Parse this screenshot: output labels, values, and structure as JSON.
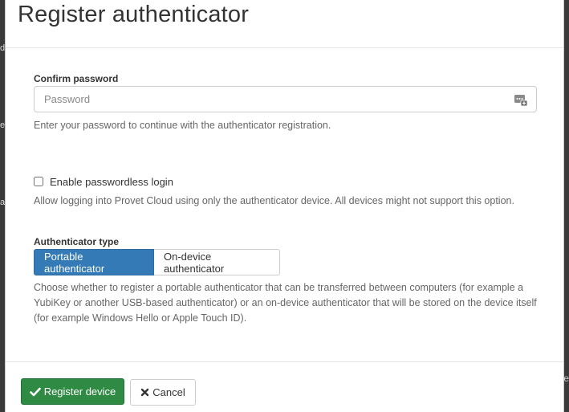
{
  "background": {
    "left_fragments": [
      "d",
      "e",
      "at"
    ],
    "right_fragment": "re"
  },
  "modal": {
    "title": "Register authenticator",
    "confirm_password": {
      "label": "Confirm password",
      "placeholder": "Password",
      "value": "",
      "help": "Enter your password to continue with the authenticator registration.",
      "icon": "password-manager-icon"
    },
    "passwordless": {
      "label": "Enable passwordless login",
      "checked": false,
      "help": "Allow logging into Provet Cloud using only the authenticator device. All devices might not support this option."
    },
    "authenticator_type": {
      "label": "Authenticator type",
      "options": [
        "Portable authenticator",
        "On-device authenticator"
      ],
      "selected": "Portable authenticator",
      "help": "Choose whether to register a portable authenticator that can be transferred between computers (for example a YubiKey or another USB-based authenticator) or an on-device authenticator that will be stored on the device itself (for example Windows Hello or Apple Touch ID)."
    },
    "footer": {
      "register_label": "Register device",
      "register_icon": "checkmark-icon",
      "cancel_label": "Cancel",
      "cancel_icon": "times-icon"
    }
  },
  "colors": {
    "primary": "#337ab7",
    "success": "#2f8a44",
    "backdrop": "#3a3a3a"
  }
}
